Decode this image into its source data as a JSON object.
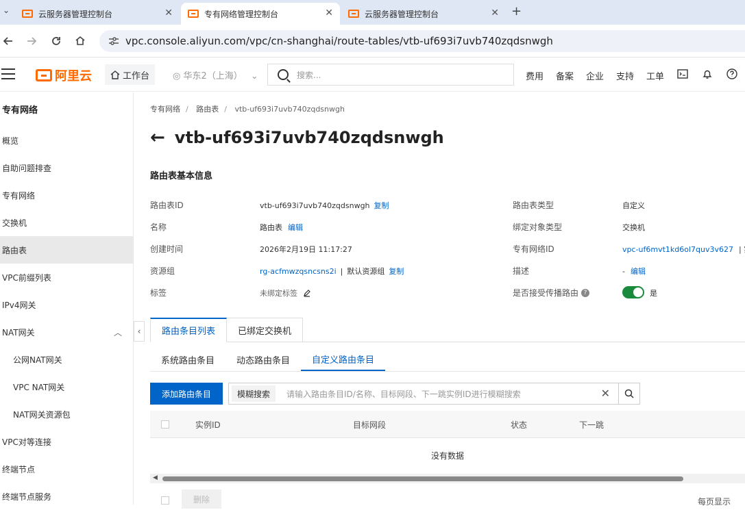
{
  "browser": {
    "tabs": [
      {
        "title": "云服务器管理控制台",
        "active": false
      },
      {
        "title": "专有网络管理控制台",
        "active": true
      },
      {
        "title": "云服务器管理控制台",
        "active": false
      }
    ],
    "close_glyph": "✕",
    "new_tab_glyph": "+",
    "tab_menu_glyph": "⌄",
    "url": "vpc.console.aliyun.com/vpc/cn-shanghai/route-tables/vtb-uf693i7uvb740zqdsnwgh"
  },
  "header": {
    "logo_text": "阿里云",
    "workbench": "工作台",
    "region": "华东2（上海）",
    "search_placeholder": "搜索...",
    "links": [
      "费用",
      "备案",
      "企业",
      "支持",
      "工单"
    ]
  },
  "sidebar": {
    "title": "专有网络",
    "items": [
      {
        "label": "概览",
        "active": false,
        "sub": false
      },
      {
        "label": "自助问题排查",
        "active": false,
        "sub": false
      },
      {
        "label": "专有网络",
        "active": false,
        "sub": false
      },
      {
        "label": "交换机",
        "active": false,
        "sub": false
      },
      {
        "label": "路由表",
        "active": true,
        "sub": false
      },
      {
        "label": "VPC前缀列表",
        "active": false,
        "sub": false
      },
      {
        "label": "IPv4网关",
        "active": false,
        "sub": false
      },
      {
        "label": "NAT网关",
        "active": false,
        "sub": false,
        "expanded": true
      },
      {
        "label": "公网NAT网关",
        "active": false,
        "sub": true
      },
      {
        "label": "VPC NAT网关",
        "active": false,
        "sub": true
      },
      {
        "label": "NAT网关资源包",
        "active": false,
        "sub": true
      },
      {
        "label": "VPC对等连接",
        "active": false,
        "sub": false
      },
      {
        "label": "终端节点",
        "active": false,
        "sub": false
      },
      {
        "label": "终端节点服务",
        "active": false,
        "sub": false
      }
    ]
  },
  "breadcrumb": [
    "专有网络",
    "路由表",
    "vtb-uf693i7uvb740zqdsnwgh"
  ],
  "page_title": "vtb-uf693i7uvb740zqdsnwgh",
  "basic_info": {
    "section_title": "路由表基本信息",
    "left": [
      {
        "label": "路由表ID",
        "value": "vtb-uf693i7uvb740zqdsnwgh",
        "action": "复制"
      },
      {
        "label": "名称",
        "value": "路由表",
        "action": "编辑"
      },
      {
        "label": "创建时间",
        "value": "2026年2月19日 11:17:27"
      },
      {
        "label": "资源组",
        "value": "rg-acfmwzqsncsns2i",
        "extra": "默认资源组",
        "action": "复制"
      },
      {
        "label": "标签",
        "value": "未绑定标签"
      }
    ],
    "right": [
      {
        "label": "路由表类型",
        "value": "自定义"
      },
      {
        "label": "绑定对象类型",
        "value": "交换机"
      },
      {
        "label": "专有网络ID",
        "value": "vpc-uf6mvt1kd6ol7quv3v627",
        "suffix": "| 实"
      },
      {
        "label": "描述",
        "value": "-",
        "action": "编辑"
      },
      {
        "label": "是否接受传播路由",
        "value": "是",
        "toggle_on": true
      }
    ]
  },
  "tabs": {
    "main": [
      {
        "label": "路由条目列表",
        "active": true
      },
      {
        "label": "已绑定交换机",
        "active": false
      }
    ],
    "sub": [
      {
        "label": "系统路由条目",
        "active": false
      },
      {
        "label": "动态路由条目",
        "active": false
      },
      {
        "label": "自定义路由条目",
        "active": true
      }
    ]
  },
  "toolbar": {
    "add_button": "添加路由条目",
    "search_mode": "模糊搜索",
    "search_placeholder": "请输入路由条目ID/名称、目标网段、下一跳实例ID进行模糊搜索"
  },
  "table": {
    "columns": [
      "实例ID",
      "目标网段",
      "状态",
      "下一跳"
    ],
    "empty_text": "没有数据"
  },
  "footer": {
    "delete_button": "删除",
    "per_page_label": "每页显示"
  },
  "colors": {
    "brand": "#ff6a00",
    "primary": "#0064c8",
    "toggle_on": "#1a8a3c"
  }
}
